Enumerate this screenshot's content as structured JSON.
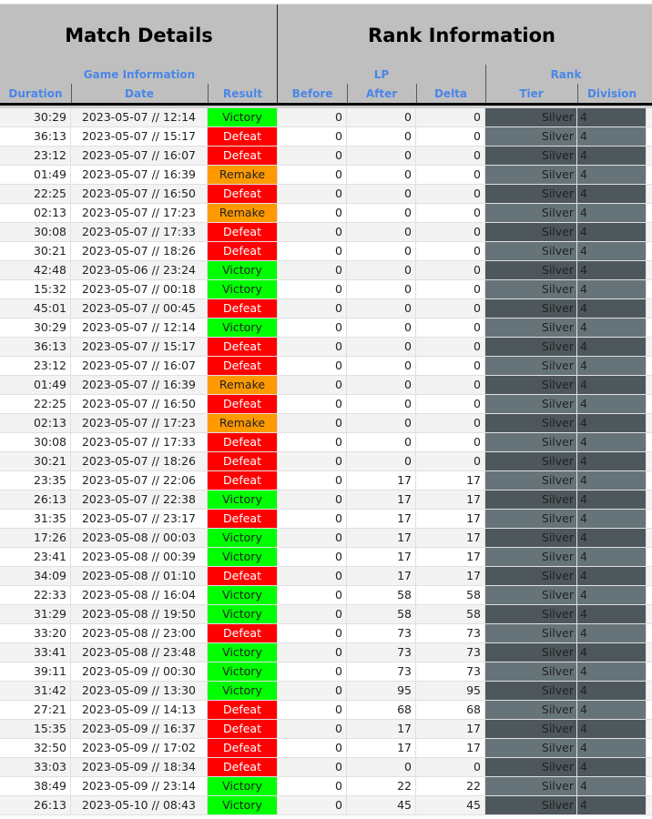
{
  "header": {
    "match_details": "Match Details",
    "rank_information": "Rank Information",
    "game_information": "Game Information",
    "lp": "LP",
    "rank": "Rank",
    "columns": {
      "duration": "Duration",
      "date": "Date",
      "result": "Result",
      "before": "Before",
      "after": "After",
      "delta": "Delta",
      "tier": "Tier",
      "division": "Division"
    }
  },
  "colors": {
    "victory": "#00ff00",
    "defeat": "#ff0000",
    "remake": "#ff9900",
    "header_bg": "#bfbfbf",
    "header_text": "#4a86e8"
  },
  "rows": [
    [
      "30:29",
      "2023-05-07 // 12:14",
      "Victory",
      "0",
      "0",
      "0",
      "Silver",
      "4"
    ],
    [
      "36:13",
      "2023-05-07 // 15:17",
      "Defeat",
      "0",
      "0",
      "0",
      "Silver",
      "4"
    ],
    [
      "23:12",
      "2023-05-07 // 16:07",
      "Defeat",
      "0",
      "0",
      "0",
      "Silver",
      "4"
    ],
    [
      "01:49",
      "2023-05-07 // 16:39",
      "Remake",
      "0",
      "0",
      "0",
      "Silver",
      "4"
    ],
    [
      "22:25",
      "2023-05-07 // 16:50",
      "Defeat",
      "0",
      "0",
      "0",
      "Silver",
      "4"
    ],
    [
      "02:13",
      "2023-05-07 // 17:23",
      "Remake",
      "0",
      "0",
      "0",
      "Silver",
      "4"
    ],
    [
      "30:08",
      "2023-05-07 // 17:33",
      "Defeat",
      "0",
      "0",
      "0",
      "Silver",
      "4"
    ],
    [
      "30:21",
      "2023-05-07 // 18:26",
      "Defeat",
      "0",
      "0",
      "0",
      "Silver",
      "4"
    ],
    [
      "42:48",
      "2023-05-06 // 23:24",
      "Victory",
      "0",
      "0",
      "0",
      "Silver",
      "4"
    ],
    [
      "15:32",
      "2023-05-07 // 00:18",
      "Victory",
      "0",
      "0",
      "0",
      "Silver",
      "4"
    ],
    [
      "45:01",
      "2023-05-07 // 00:45",
      "Defeat",
      "0",
      "0",
      "0",
      "Silver",
      "4"
    ],
    [
      "30:29",
      "2023-05-07 // 12:14",
      "Victory",
      "0",
      "0",
      "0",
      "Silver",
      "4"
    ],
    [
      "36:13",
      "2023-05-07 // 15:17",
      "Defeat",
      "0",
      "0",
      "0",
      "Silver",
      "4"
    ],
    [
      "23:12",
      "2023-05-07 // 16:07",
      "Defeat",
      "0",
      "0",
      "0",
      "Silver",
      "4"
    ],
    [
      "01:49",
      "2023-05-07 // 16:39",
      "Remake",
      "0",
      "0",
      "0",
      "Silver",
      "4"
    ],
    [
      "22:25",
      "2023-05-07 // 16:50",
      "Defeat",
      "0",
      "0",
      "0",
      "Silver",
      "4"
    ],
    [
      "02:13",
      "2023-05-07 // 17:23",
      "Remake",
      "0",
      "0",
      "0",
      "Silver",
      "4"
    ],
    [
      "30:08",
      "2023-05-07 // 17:33",
      "Defeat",
      "0",
      "0",
      "0",
      "Silver",
      "4"
    ],
    [
      "30:21",
      "2023-05-07 // 18:26",
      "Defeat",
      "0",
      "0",
      "0",
      "Silver",
      "4"
    ],
    [
      "23:35",
      "2023-05-07 // 22:06",
      "Defeat",
      "0",
      "17",
      "17",
      "Silver",
      "4"
    ],
    [
      "26:13",
      "2023-05-07 // 22:38",
      "Victory",
      "0",
      "17",
      "17",
      "Silver",
      "4"
    ],
    [
      "31:35",
      "2023-05-07 // 23:17",
      "Defeat",
      "0",
      "17",
      "17",
      "Silver",
      "4"
    ],
    [
      "17:26",
      "2023-05-08 // 00:03",
      "Victory",
      "0",
      "17",
      "17",
      "Silver",
      "4"
    ],
    [
      "23:41",
      "2023-05-08 // 00:39",
      "Victory",
      "0",
      "17",
      "17",
      "Silver",
      "4"
    ],
    [
      "34:09",
      "2023-05-08 // 01:10",
      "Defeat",
      "0",
      "17",
      "17",
      "Silver",
      "4"
    ],
    [
      "22:33",
      "2023-05-08 // 16:04",
      "Victory",
      "0",
      "58",
      "58",
      "Silver",
      "4"
    ],
    [
      "31:29",
      "2023-05-08 // 19:50",
      "Victory",
      "0",
      "58",
      "58",
      "Silver",
      "4"
    ],
    [
      "33:20",
      "2023-05-08 // 23:00",
      "Defeat",
      "0",
      "73",
      "73",
      "Silver",
      "4"
    ],
    [
      "33:41",
      "2023-05-08 // 23:48",
      "Victory",
      "0",
      "73",
      "73",
      "Silver",
      "4"
    ],
    [
      "39:11",
      "2023-05-09 // 00:30",
      "Victory",
      "0",
      "73",
      "73",
      "Silver",
      "4"
    ],
    [
      "31:42",
      "2023-05-09 // 13:30",
      "Victory",
      "0",
      "95",
      "95",
      "Silver",
      "4"
    ],
    [
      "27:21",
      "2023-05-09 // 14:13",
      "Defeat",
      "0",
      "68",
      "68",
      "Silver",
      "4"
    ],
    [
      "15:35",
      "2023-05-09 // 16:37",
      "Defeat",
      "0",
      "17",
      "17",
      "Silver",
      "4"
    ],
    [
      "32:50",
      "2023-05-09 // 17:02",
      "Defeat",
      "0",
      "17",
      "17",
      "Silver",
      "4"
    ],
    [
      "33:03",
      "2023-05-09 // 18:34",
      "Defeat",
      "0",
      "0",
      "0",
      "Silver",
      "4"
    ],
    [
      "38:49",
      "2023-05-09 // 23:14",
      "Victory",
      "0",
      "22",
      "22",
      "Silver",
      "4"
    ],
    [
      "26:13",
      "2023-05-10 // 08:43",
      "Victory",
      "0",
      "45",
      "45",
      "Silver",
      "4"
    ]
  ]
}
